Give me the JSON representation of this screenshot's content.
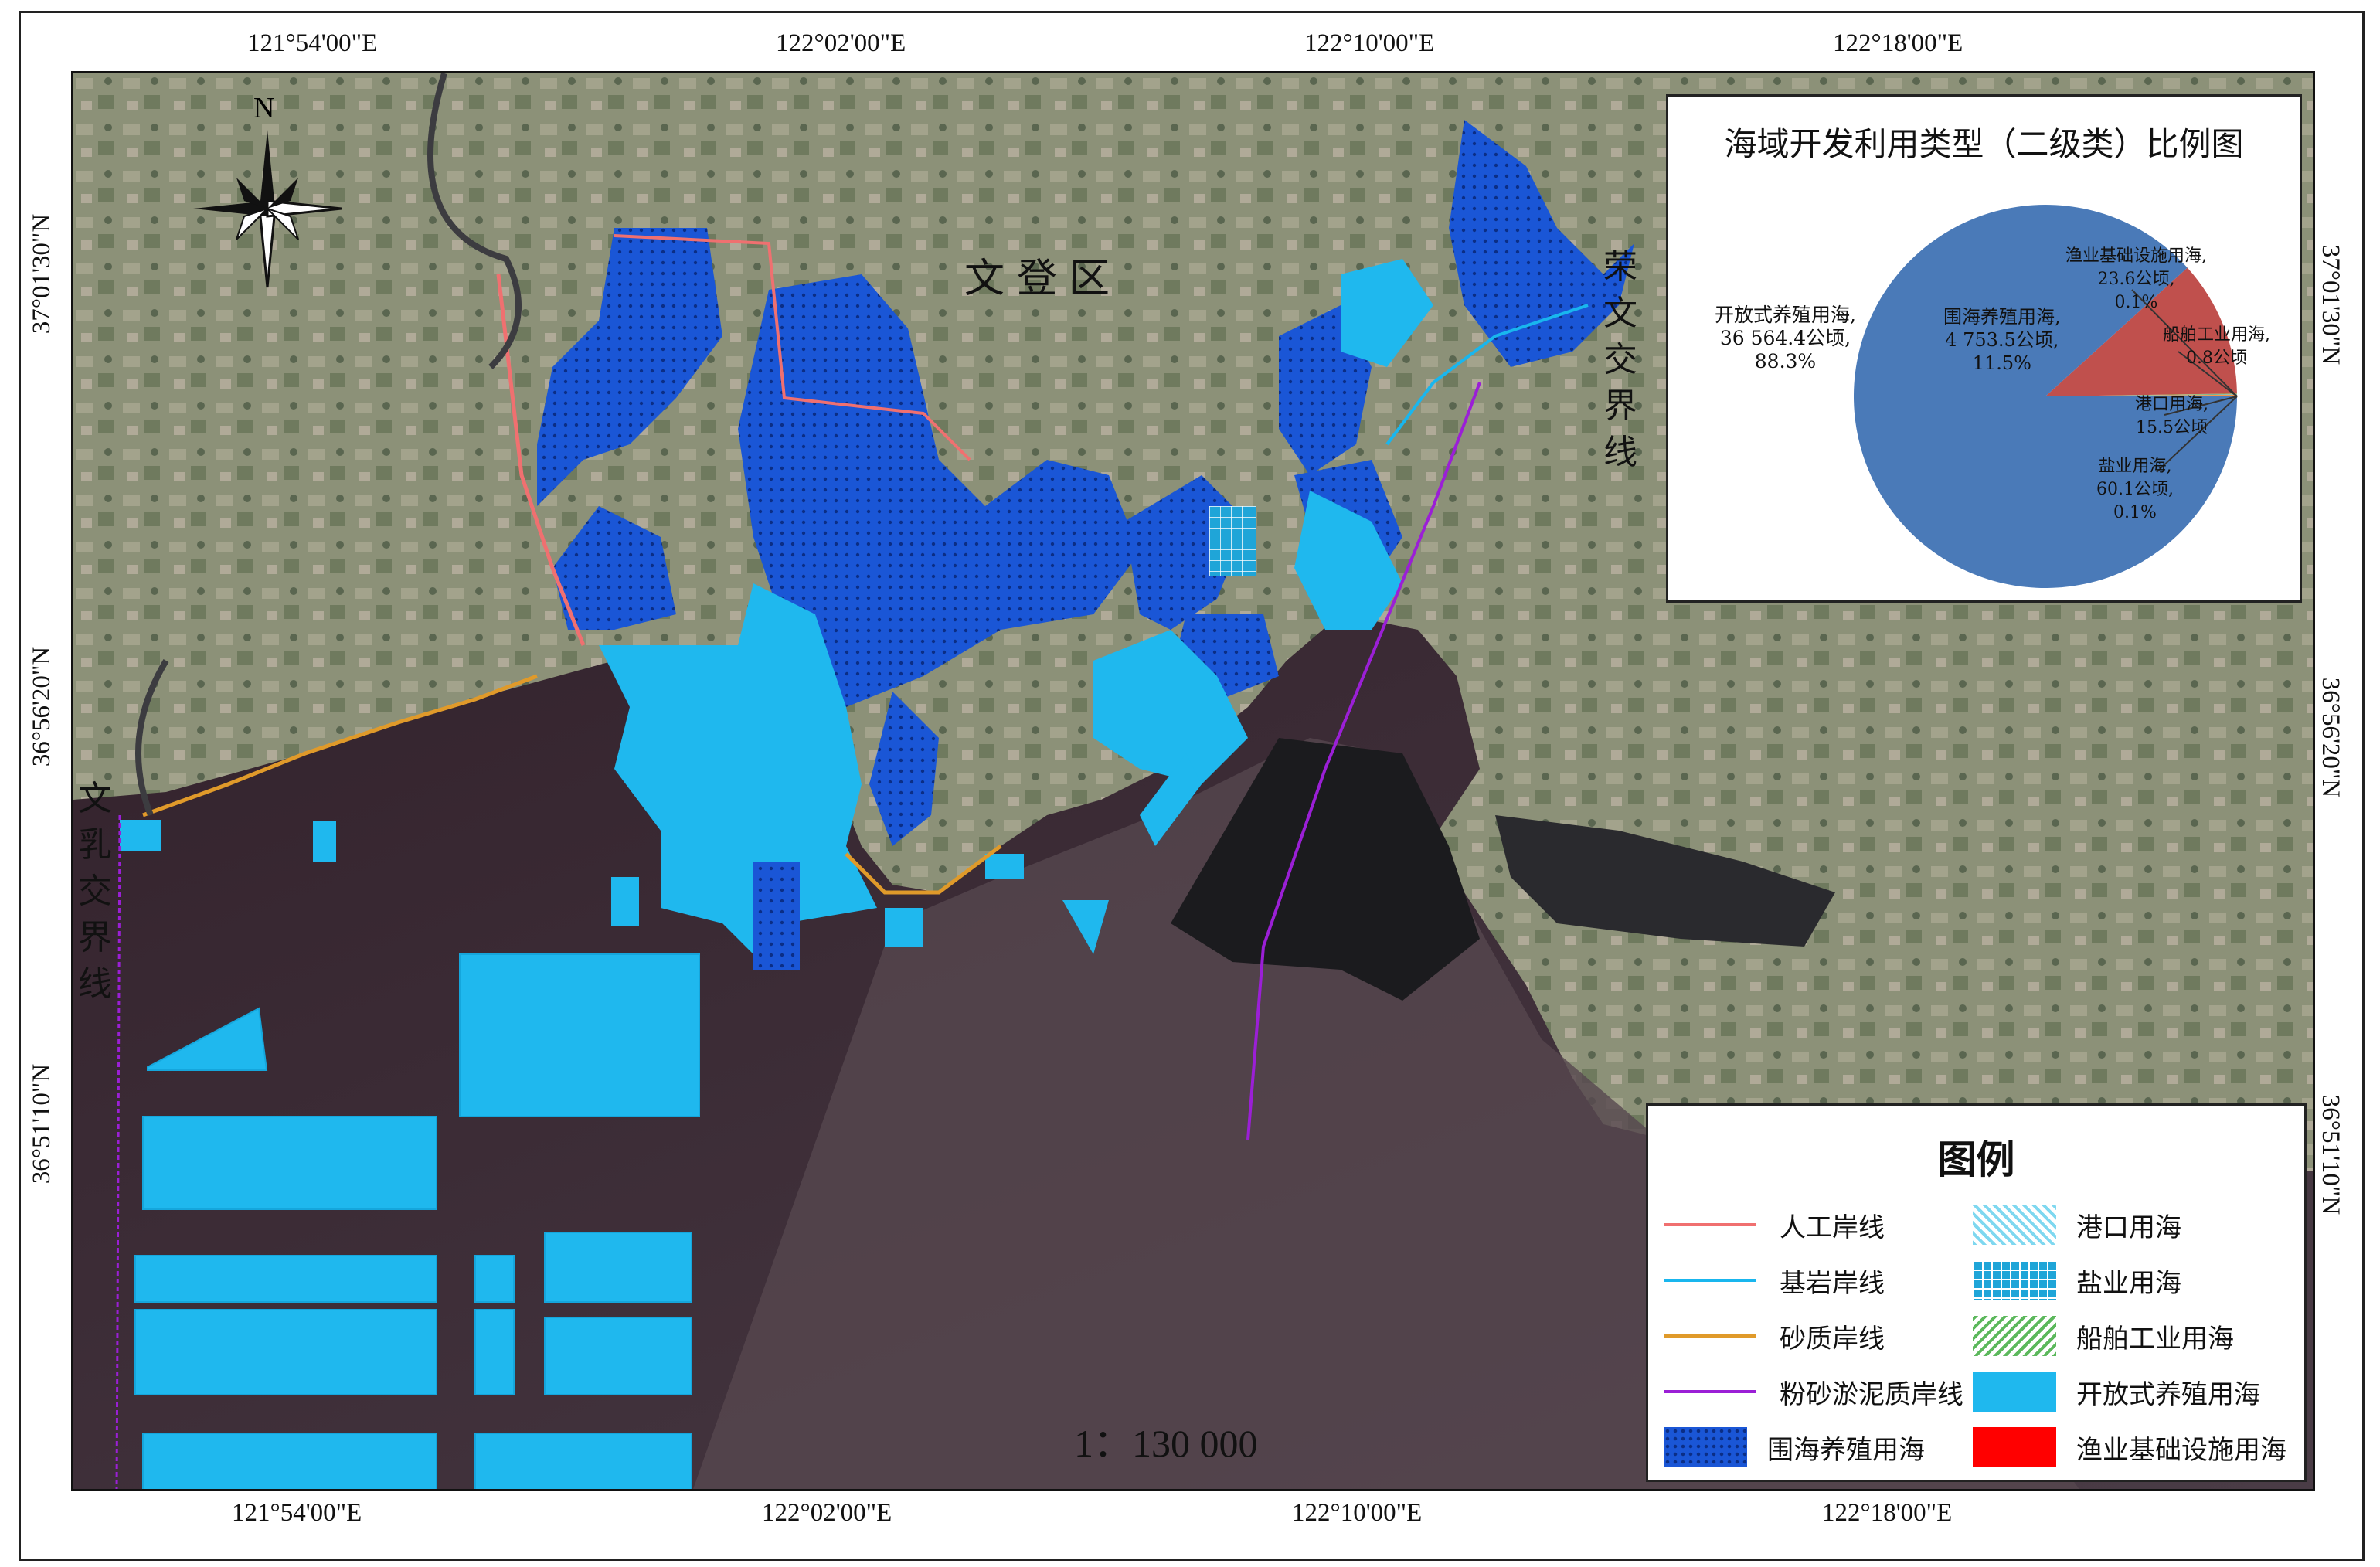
{
  "map": {
    "scale": "1：130 000",
    "north": "N",
    "place_labels": {
      "wendeng": "文登区",
      "rushan_boundary": "文乳交界线",
      "rongcheng_boundary": "荣文交界线"
    },
    "coords": {
      "top": [
        "121°54'00\"E",
        "122°02'00\"E",
        "122°10'00\"E",
        "122°18'00\"E"
      ],
      "bottom": [
        "121°54'00\"E",
        "122°02'00\"E",
        "122°10'00\"E",
        "122°18'00\"E"
      ],
      "left": [
        "37°01'30\"N",
        "36°56'20\"N",
        "36°51'10\"N"
      ],
      "right": [
        "37°01'30\"N",
        "36°56'20\"N",
        "36°51'10\"N"
      ]
    },
    "colors": {
      "sea": "#3a2b34",
      "land": "#8a8f75",
      "open_aquaculture": "#1fb8ee",
      "enclosed_aquaculture": "#1a56d6",
      "artificial_coast": "#f07070",
      "bedrock_coast": "#19b6ee",
      "sandy_coast": "#e09a2a",
      "silty_coast": "#9b1fd6"
    }
  },
  "pie": {
    "title": "海域开发利用类型（二级类）比例图",
    "chart_data": {
      "type": "pie",
      "unit": "公顷",
      "slices": [
        {
          "name": "开放式养殖用海",
          "value": 36564.4,
          "percent": 88.3,
          "color": "#4a7ab8",
          "label": [
            "开放式养殖用海,",
            "36 564.4公顷,",
            "88.3%"
          ]
        },
        {
          "name": "围海养殖用海",
          "value": 4753.5,
          "percent": 11.5,
          "color": "#c0504d",
          "label": [
            "围海养殖用海,",
            "4 753.5公顷,",
            "11.5%"
          ]
        },
        {
          "name": "渔业基础设施用海",
          "value": 23.6,
          "percent": 0.1,
          "color": "#9bbb59",
          "label": [
            "渔业基础设施用海,",
            "23.6公顷,",
            "0.1%"
          ]
        },
        {
          "name": "船舶工业用海",
          "value": 0.8,
          "percent": 0.0,
          "color": "#8064a2",
          "label": [
            "船舶工业用海,",
            "0.8公顷"
          ]
        },
        {
          "name": "港口用海",
          "value": 15.5,
          "percent": 0.0,
          "color": "#4bacc6",
          "label": [
            "港口用海,",
            "15.5公顷"
          ]
        },
        {
          "name": "盐业用海",
          "value": 60.1,
          "percent": 0.1,
          "color": "#f79646",
          "label": [
            "盐业用海,",
            "60.1公顷,",
            "0.1%"
          ]
        }
      ]
    }
  },
  "legend": {
    "title": "图例",
    "lines": [
      {
        "label": "人工岸线",
        "color": "#f07070"
      },
      {
        "label": "基岩岸线",
        "color": "#19b6ee"
      },
      {
        "label": "砂质岸线",
        "color": "#e09a2a"
      },
      {
        "label": "粉砂淤泥质岸线",
        "color": "#9b1fd6"
      }
    ],
    "areas": [
      {
        "label": "围海养殖用海",
        "color": "#1a56d6",
        "pattern": "dots"
      },
      {
        "label": "港口用海",
        "color": "#7fd8f0",
        "pattern": "diag"
      },
      {
        "label": "盐业用海",
        "color": "#1fa5d8",
        "pattern": "grid"
      },
      {
        "label": "船舶工业用海",
        "color": "#5cb85c",
        "pattern": "diag-green"
      },
      {
        "label": "开放式养殖用海",
        "color": "#1fb8ee",
        "pattern": "solid"
      },
      {
        "label": "渔业基础设施用海",
        "color": "#ff0000",
        "pattern": "solid"
      }
    ]
  }
}
